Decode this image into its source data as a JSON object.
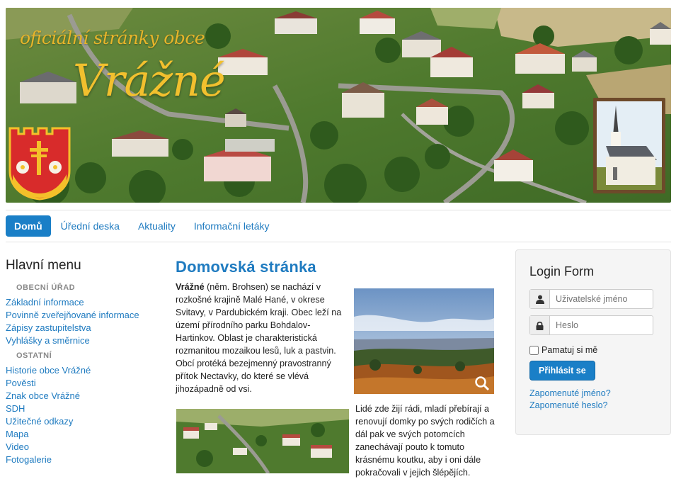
{
  "banner": {
    "tagline": "oficiální stránky obce",
    "title": "Vrážné"
  },
  "nav": {
    "items": [
      {
        "label": "Domů",
        "active": true
      },
      {
        "label": "Úřední deska",
        "active": false
      },
      {
        "label": "Aktuality",
        "active": false
      },
      {
        "label": "Informační letáky",
        "active": false
      }
    ]
  },
  "main_menu": {
    "title": "Hlavní menu",
    "section_office": "OBECNÍ ÚŘAD",
    "office_links": [
      "Základní informace",
      "Povinně zveřejňované informace",
      "Zápisy zastupitelstva",
      "Vyhlášky a směrnice"
    ],
    "section_other": "OSTATNÍ",
    "other_links": [
      "Historie obce Vrážné",
      "Pověsti",
      "Znak obce Vrážné",
      "SDH",
      "Užitečné odkazy",
      "Mapa",
      "Video",
      "Fotogalerie"
    ]
  },
  "content": {
    "title": "Domovská stránka",
    "para1_bold": "Vrážné",
    "para1_rest": " (něm. Brohsen) se nachází v rozkošné krajině Malé Hané, v okrese Svitavy, v Pardubickém kraji. Obec leží na území přírodního parku Bohdalov-Hartinkov. Oblast je charakteristická rozmanitou mozaikou lesů, luk a pastvin. Obcí protéká bezejmenný pravostranný přítok Nectavky, do které se vlévá jihozápadně od vsi.",
    "para2": "Lidé zde žijí rádi, mladí přebírají a renovují domky po svých rodičích a dál pak ve svých potomcích zanechávají pouto k tomuto krásnému koutku, aby i oni dále pokračovali v jejich šlépějích."
  },
  "login": {
    "title": "Login Form",
    "username_placeholder": "Uživatelské jméno",
    "password_placeholder": "Heslo",
    "remember_label": "Pamatuj si mě",
    "submit_label": "Přihlásit se",
    "forgot_username": "Zapomenuté jméno?",
    "forgot_password": "Zapomenuté heslo?"
  },
  "colors": {
    "accent": "#1a7fc7",
    "link": "#1f7bc0",
    "banner_text": "#f2c02e"
  }
}
